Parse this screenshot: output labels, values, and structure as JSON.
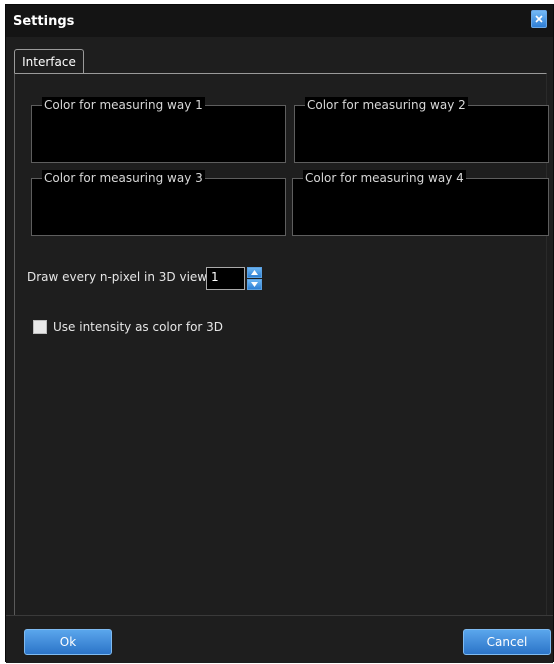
{
  "window": {
    "title": "Settings"
  },
  "tabs": [
    {
      "label": "Interface"
    }
  ],
  "color_groups": [
    {
      "label": "Color for measuring way 1"
    },
    {
      "label": "Color for measuring way 2"
    },
    {
      "label": "Color for measuring way 3"
    },
    {
      "label": "Color for measuring way 4"
    }
  ],
  "draw_pixel": {
    "label": "Draw every n-pixel in 3D view",
    "value": "1"
  },
  "intensity_option": {
    "label": "Use intensity as color for 3D",
    "checked": false
  },
  "buttons": {
    "ok": "Ok",
    "cancel": "Cancel"
  },
  "colors": {
    "accent": "#2f7fd6",
    "background": "#1e1e1e",
    "groupbox_bg": "#000000"
  }
}
